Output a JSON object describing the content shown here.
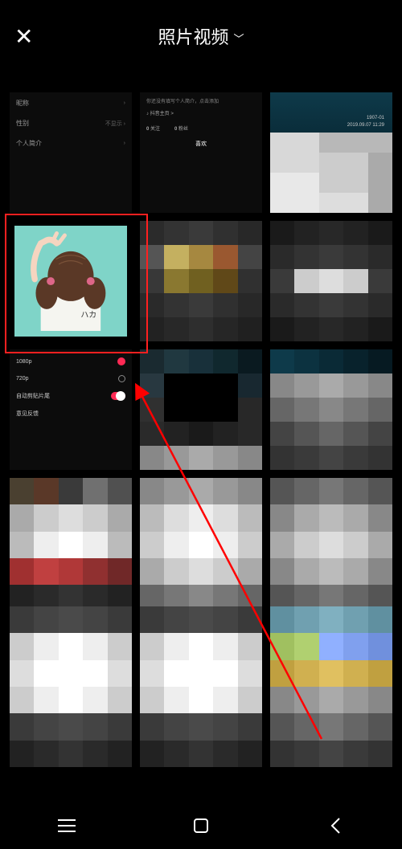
{
  "header": {
    "close_aria": "Close",
    "title": "照片视频",
    "dropdown_chevron": "﹀"
  },
  "cells": {
    "r1c1": {
      "row1_label": "昵称",
      "row1_right": "›",
      "row2_label": "性别",
      "row2_right": "不显示 ›",
      "row3_label": "个人简介",
      "row3_right": "›"
    },
    "r1c2": {
      "hint": "你还没有填写个人简介，点击添加",
      "music_icon": "♪",
      "music_label": "抖音主页 >",
      "stat1_num": "0",
      "stat1_label": "关注",
      "stat2_num": "0",
      "stat2_label": "粉丝",
      "tab_like": "喜欢"
    },
    "r1c3": {
      "line1": "1907-01",
      "line2": "2019.09.07 11:29"
    },
    "r3c1": {
      "opt1": "1080p",
      "opt2": "720p",
      "opt3": "自动剪贴片尾",
      "opt4": "意见反馈"
    }
  },
  "colors": {
    "highlight_red": "#ff2020",
    "arrow_red": "#ff0000",
    "accent_pink": "#ff2a55",
    "avatar_bg": "#7fd4c8"
  },
  "nav": {
    "menu": "menu",
    "home": "home",
    "back": "back"
  }
}
